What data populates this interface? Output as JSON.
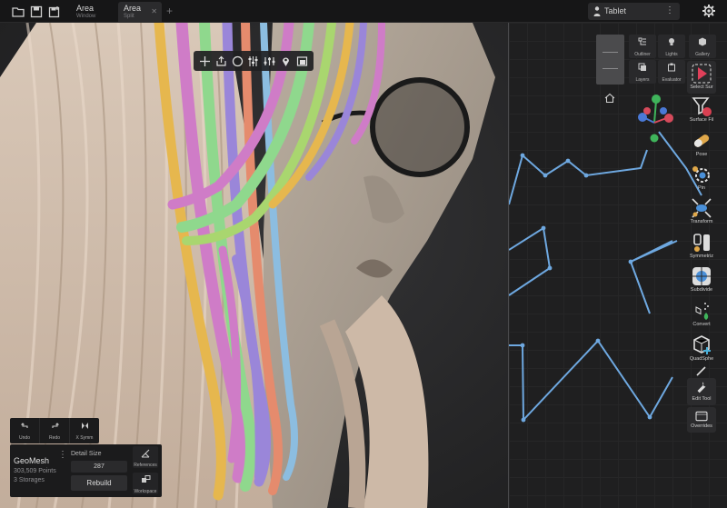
{
  "topbar": {
    "tabs": [
      {
        "title": "Area",
        "subtitle": "Window"
      },
      {
        "title": "Area",
        "subtitle": "Split"
      }
    ],
    "device_label": "Tablet"
  },
  "viewport_toolbar": {
    "icons": [
      "plus-icon",
      "export-icon",
      "circle-icon",
      "sliders-icon",
      "mixer-icon",
      "pin-icon",
      "frame-icon"
    ]
  },
  "right_panel": {
    "top_buttons": [
      {
        "label": "Outliner",
        "icon": "outliner-icon"
      },
      {
        "label": "Lights",
        "icon": "bulb-icon"
      },
      {
        "label": "Gallery",
        "icon": "cube-icon"
      },
      {
        "label": "Layers",
        "icon": "layers-icon"
      },
      {
        "label": "Evaluator",
        "icon": "evaluator-icon"
      }
    ],
    "tools": [
      {
        "label": "Select Sur",
        "icon": "select-icon"
      },
      {
        "label": "Surface Fil",
        "icon": "filter-icon"
      },
      {
        "label": "Pose",
        "icon": "pose-icon"
      },
      {
        "label": "Pin",
        "icon": "pin-gear-icon"
      },
      {
        "label": "Transform",
        "icon": "transform-icon"
      },
      {
        "label": "Symmetriz",
        "icon": "symmetrize-icon"
      },
      {
        "label": "Subdivide",
        "icon": "subdivide-icon"
      },
      {
        "label": "Convert",
        "icon": "convert-icon"
      },
      {
        "label": "QuadSphe",
        "icon": "quadsphere-icon"
      },
      {
        "label": "Edit Tool",
        "icon": "wrench-icon"
      },
      {
        "label": "Overrides",
        "icon": "overrides-icon"
      }
    ]
  },
  "bottom_panel": {
    "undo_label": "Undo",
    "redo_label": "Redo",
    "symmetry_label": "X Symm",
    "mesh_name": "GeoMesh",
    "points": "303,509 Points",
    "storages": "3 Storages",
    "detail_label": "Detail Size",
    "detail_value": "287",
    "rebuild_label": "Rebuild",
    "references_label": "References",
    "workspace_label": "Workspace"
  },
  "colors": {
    "accent_blue": "#6ea8e0",
    "graph_bg": "#1f1f20",
    "hair_base": "#d6c3b3",
    "strand_colors": [
      "#e6b74e",
      "#cf7cc7",
      "#8fd88d",
      "#9a86d9",
      "#e58b6d",
      "#8cbde0",
      "#a9d66f"
    ]
  }
}
